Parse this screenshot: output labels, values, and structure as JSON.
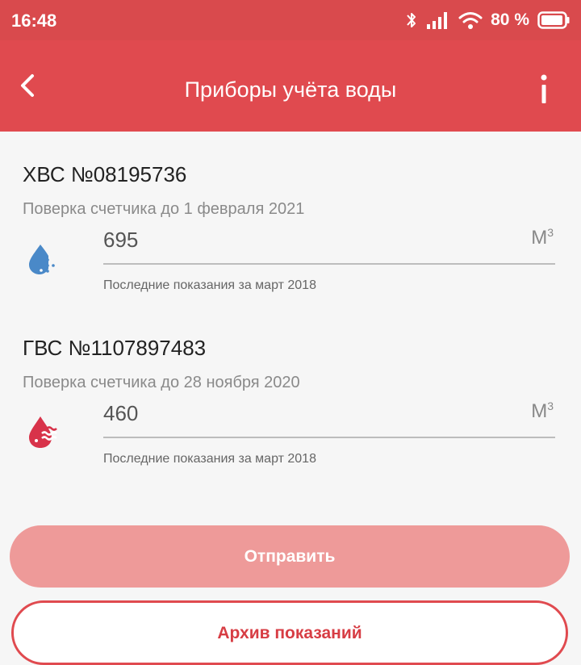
{
  "status_bar": {
    "time": "16:48",
    "battery": "80 %",
    "icons": [
      "bluetooth-icon",
      "signal-icon",
      "wifi-icon",
      "battery-icon"
    ]
  },
  "toolbar": {
    "title": "Приборы учёта воды",
    "back_icon": "back-arrow-icon",
    "info_icon": "info-icon"
  },
  "meters": [
    {
      "title": "ХВС №08195736",
      "verification": "Поверка счетчика до 1 февраля 2021",
      "value": "695",
      "unit": "М",
      "unit_sup": "3",
      "hint": "Последние показания за март 2018",
      "icon": "cold-water-drop-icon",
      "color": "#4a89c8"
    },
    {
      "title": "ГВС №1107897483",
      "verification": "Поверка счетчика до 28 ноября 2020",
      "value": "460",
      "unit": "М",
      "unit_sup": "3",
      "hint": "Последние показания за март 2018",
      "icon": "hot-water-drop-icon",
      "color": "#d8334a"
    }
  ],
  "actions": {
    "send_label": "Отправить",
    "archive_label": "Архив показаний"
  },
  "colors": {
    "accent": "#e04a4f",
    "statusbar": "#d94a4d",
    "send_button": "#ee9a99"
  }
}
